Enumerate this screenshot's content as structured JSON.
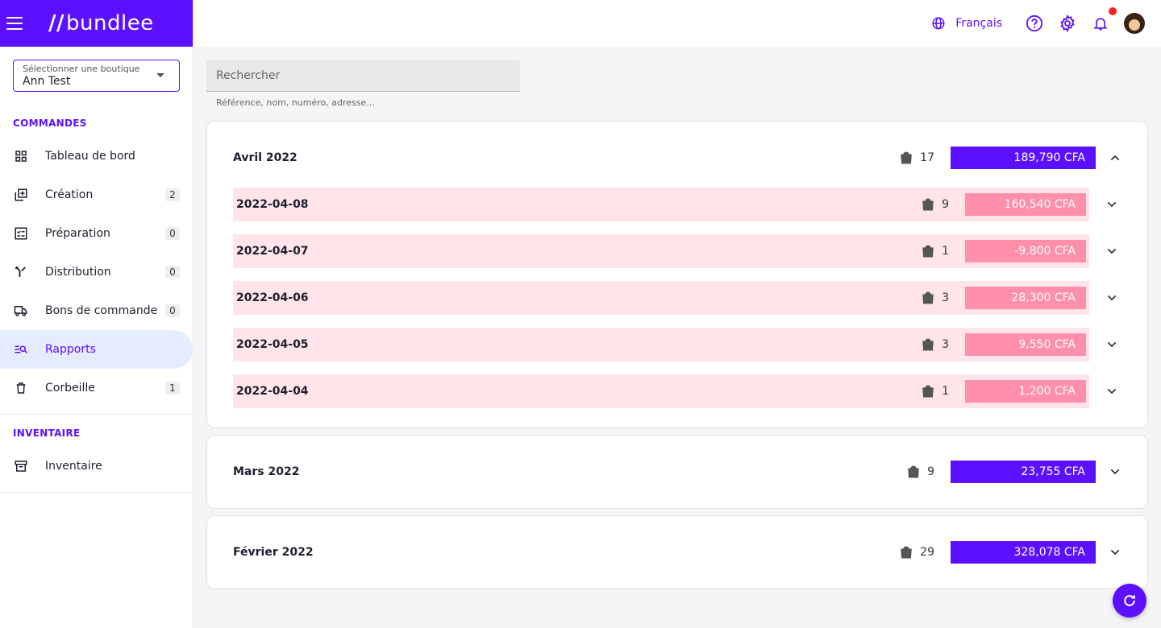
{
  "brand": {
    "logo_text": "bundlee",
    "logo_mark": "//"
  },
  "sidebar": {
    "store_select": {
      "label": "Sélectionner une boutique",
      "value": "Ann Test"
    },
    "sections": [
      {
        "title": "COMMANDES",
        "items": [
          {
            "label": "Tableau de bord",
            "icon": "dashboard-icon",
            "count": ""
          },
          {
            "label": "Création",
            "icon": "library-add-icon",
            "count": "2"
          },
          {
            "label": "Préparation",
            "icon": "checklist-icon",
            "count": "0"
          },
          {
            "label": "Distribution",
            "icon": "merge-icon",
            "count": "0"
          },
          {
            "label": "Bons de commande",
            "icon": "truck-icon",
            "count": "0"
          },
          {
            "label": "Rapports",
            "icon": "manage-search-icon",
            "count": ""
          },
          {
            "label": "Corbeille",
            "icon": "trash-icon",
            "count": "1"
          }
        ]
      },
      {
        "title": "INVENTAIRE",
        "items": [
          {
            "label": "Inventaire",
            "icon": "archive-icon",
            "count": ""
          }
        ]
      }
    ]
  },
  "topbar": {
    "language": "Français"
  },
  "search": {
    "placeholder": "Rechercher",
    "helper": "Référence, nom, numéro, adresse..."
  },
  "months": [
    {
      "title": "Avril 2022",
      "orders": "17",
      "amount": "189,790 CFA",
      "expanded": true,
      "days": [
        {
          "date": "2022-04-08",
          "orders": "9",
          "amount": "160,540 CFA"
        },
        {
          "date": "2022-04-07",
          "orders": "1",
          "amount": "-9,800 CFA"
        },
        {
          "date": "2022-04-06",
          "orders": "3",
          "amount": "28,300 CFA"
        },
        {
          "date": "2022-04-05",
          "orders": "3",
          "amount": "9,550 CFA"
        },
        {
          "date": "2022-04-04",
          "orders": "1",
          "amount": "1,200 CFA"
        }
      ]
    },
    {
      "title": "Mars 2022",
      "orders": "9",
      "amount": "23,755 CFA",
      "expanded": false,
      "days": []
    },
    {
      "title": "Février 2022",
      "orders": "29",
      "amount": "328,078 CFA",
      "expanded": false,
      "days": []
    }
  ],
  "colors": {
    "accent": "#5b10ff",
    "row_bg": "#ffe5e9",
    "row_amount": "#ff8fab",
    "notification": "#ff2020"
  }
}
